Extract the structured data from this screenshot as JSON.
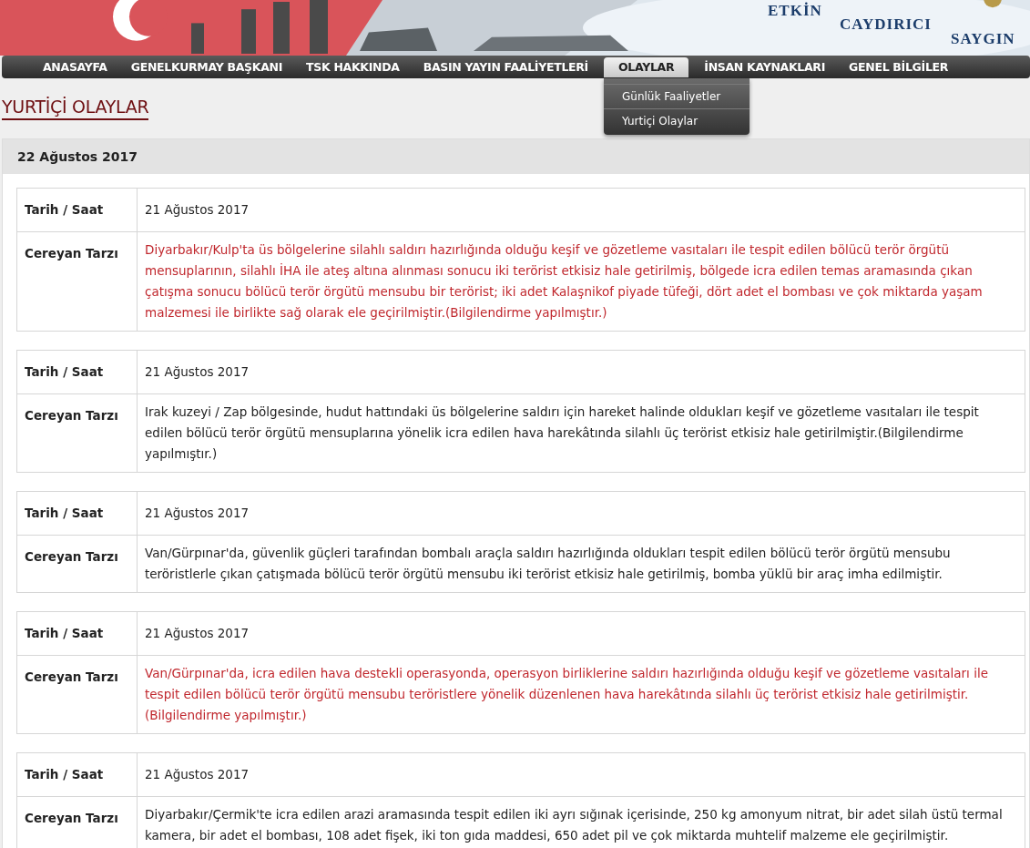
{
  "banner": {
    "slogans": [
      "ETKİN",
      "CAYDIRICI",
      "SAYGIN"
    ]
  },
  "nav": [
    {
      "label": "ANASAYFA",
      "selected": false
    },
    {
      "label": "GENELKURMAY BAŞKANI",
      "selected": false
    },
    {
      "label": "TSK HAKKINDA",
      "selected": false
    },
    {
      "label": "BASIN YAYIN FAALİYETLERİ",
      "selected": false
    },
    {
      "label": "OLAYLAR",
      "selected": true
    },
    {
      "label": "İNSAN KAYNAKLARI",
      "selected": false
    },
    {
      "label": "GENEL BİLGİLER",
      "selected": false
    }
  ],
  "dropdown": [
    "Günlük Faaliyetler",
    "Yurtiçi Olaylar"
  ],
  "page_title": "YURTİÇİ OLAYLAR",
  "panel_date": "22 Ağustos 2017",
  "events": [
    {
      "date_label": "Tarih / Saat",
      "date": "21 Ağustos 2017",
      "desc_label": "Cereyan Tarzı",
      "highlighted": true,
      "description": "Diyarbakır/Kulp'ta üs bölgelerine silahlı saldırı hazırlığında olduğu keşif ve gözetleme vasıtaları ile tespit edilen bölücü terör örgütü mensuplarının, silahlı İHA ile ateş altına alınması sonucu iki terörist etkisiz hale getirilmiş, bölgede icra edilen temas aramasında çıkan çatışma sonucu bölücü terör örgütü mensubu bir terörist; iki adet Kalaşnikof piyade tüfeği, dört adet el bombası ve çok miktarda yaşam malzemesi ile birlikte sağ olarak ele geçirilmiştir.(Bilgilendirme yapılmıştır.)"
    },
    {
      "date_label": "Tarih / Saat",
      "date": "21 Ağustos 2017",
      "desc_label": "Cereyan Tarzı",
      "highlighted": false,
      "description": "Irak kuzeyi / Zap bölgesinde, hudut hattındaki üs bölgelerine saldırı için hareket halinde oldukları keşif ve gözetleme vasıtaları ile tespit edilen bölücü terör örgütü mensuplarına yönelik icra edilen hava harekâtında silahlı üç terörist etkisiz hale getirilmiştir.(Bilgilendirme yapılmıştır.)"
    },
    {
      "date_label": "Tarih / Saat",
      "date": "21 Ağustos 2017",
      "desc_label": "Cereyan Tarzı",
      "highlighted": false,
      "description": "Van/Gürpınar'da, güvenlik güçleri tarafından bombalı araçla saldırı hazırlığında oldukları tespit edilen bölücü terör örgütü mensubu teröristlerle çıkan çatışmada bölücü terör örgütü mensubu iki terörist etkisiz hale getirilmiş, bomba yüklü bir araç imha edilmiştir."
    },
    {
      "date_label": "Tarih / Saat",
      "date": "21 Ağustos 2017",
      "desc_label": "Cereyan Tarzı",
      "highlighted": true,
      "description": "Van/Gürpınar'da, icra edilen hava destekli operasyonda, operasyon birliklerine saldırı hazırlığında olduğu keşif ve gözetleme vasıtaları ile tespit edilen bölücü terör örgütü mensubu teröristlere yönelik düzenlenen hava harekâtında silahlı üç terörist etkisiz hale getirilmiştir.(Bilgilendirme yapılmıştır.)"
    },
    {
      "date_label": "Tarih / Saat",
      "date": "21 Ağustos 2017",
      "desc_label": "Cereyan Tarzı",
      "highlighted": false,
      "description": "Diyarbakır/Çermik'te icra edilen arazi aramasında tespit edilen iki ayrı sığınak içerisinde, 250 kg amonyum nitrat, bir adet silah üstü termal kamera, bir adet el bombası, 108 adet fişek, iki ton gıda maddesi, 650 adet pil ve çok miktarda muhtelif malzeme ele geçirilmiştir."
    }
  ]
}
